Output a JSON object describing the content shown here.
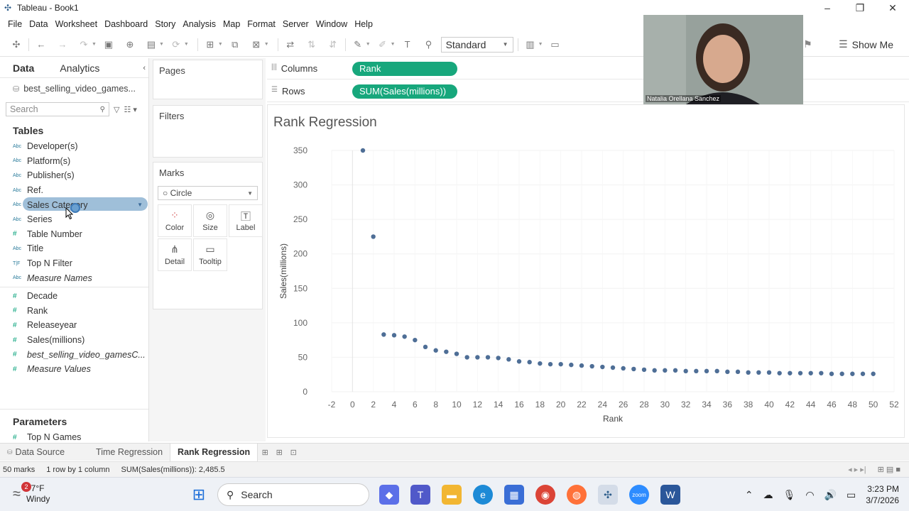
{
  "window": {
    "title": "Tableau - Book1"
  },
  "menu": [
    "File",
    "Data",
    "Worksheet",
    "Dashboard",
    "Story",
    "Analysis",
    "Map",
    "Format",
    "Server",
    "Window",
    "Help"
  ],
  "toolbar": {
    "fit": "Standard",
    "show_me": "Show Me"
  },
  "left_pane": {
    "tabs": [
      "Data",
      "Analytics"
    ],
    "datasource": "best_selling_video_games...",
    "search_placeholder": "Search",
    "tables_heading": "Tables",
    "dimensions": [
      {
        "name": "Developer(s)",
        "type": "Abc"
      },
      {
        "name": "Platform(s)",
        "type": "Abc"
      },
      {
        "name": "Publisher(s)",
        "type": "Abc"
      },
      {
        "name": "Ref.",
        "type": "Abc"
      },
      {
        "name": "Sales Category",
        "type": "Abc",
        "selected": true
      },
      {
        "name": "Series",
        "type": "Abc"
      },
      {
        "name": "Table Number",
        "type": "#"
      },
      {
        "name": "Title",
        "type": "Abc"
      },
      {
        "name": "Top N Filter",
        "type": "T|F"
      },
      {
        "name": "Measure Names",
        "type": "Abc",
        "italic": true
      }
    ],
    "measures": [
      {
        "name": "Decade",
        "type": "#"
      },
      {
        "name": "Rank",
        "type": "#"
      },
      {
        "name": "Releaseyear",
        "type": "#"
      },
      {
        "name": "Sales(millions)",
        "type": "#"
      },
      {
        "name": "best_selling_video_gamesC...",
        "type": "#",
        "italic": true
      },
      {
        "name": "Measure Values",
        "type": "#",
        "italic": true
      }
    ],
    "parameters_heading": "Parameters",
    "parameters": [
      {
        "name": "Top N Games",
        "type": "#"
      }
    ]
  },
  "cards": {
    "pages": "Pages",
    "filters": "Filters",
    "marks": "Marks",
    "mark_type": "Circle",
    "mark_buttons": [
      "Color",
      "Size",
      "Label",
      "Detail",
      "Tooltip"
    ]
  },
  "shelves": {
    "columns_label": "Columns",
    "columns_pill": "Rank",
    "rows_label": "Rows",
    "rows_pill": "SUM(Sales(millions))"
  },
  "webcam": {
    "name": "Natalia Orellana Sanchez"
  },
  "chart_data": {
    "type": "scatter",
    "title": "Rank Regression",
    "xlabel": "Rank",
    "ylabel": "Sales(millions)",
    "xlim": [
      -2,
      52
    ],
    "ylim": [
      0,
      350
    ],
    "x_ticks": [
      -2,
      0,
      2,
      4,
      6,
      8,
      10,
      12,
      14,
      16,
      18,
      20,
      22,
      24,
      26,
      28,
      30,
      32,
      34,
      36,
      38,
      40,
      42,
      44,
      46,
      48,
      50,
      52
    ],
    "y_ticks": [
      0,
      50,
      100,
      150,
      200,
      250,
      300,
      350
    ],
    "color": "#4e6e96",
    "points": [
      [
        1,
        350
      ],
      [
        2,
        225
      ],
      [
        3,
        83
      ],
      [
        4,
        82
      ],
      [
        5,
        80
      ],
      [
        6,
        75
      ],
      [
        7,
        65
      ],
      [
        8,
        60
      ],
      [
        9,
        58
      ],
      [
        10,
        55
      ],
      [
        11,
        50
      ],
      [
        12,
        50
      ],
      [
        13,
        50
      ],
      [
        14,
        49
      ],
      [
        15,
        47
      ],
      [
        16,
        44
      ],
      [
        17,
        43
      ],
      [
        18,
        41
      ],
      [
        19,
        40
      ],
      [
        20,
        40
      ],
      [
        21,
        39
      ],
      [
        22,
        38
      ],
      [
        23,
        37
      ],
      [
        24,
        36
      ],
      [
        25,
        35
      ],
      [
        26,
        34
      ],
      [
        27,
        33
      ],
      [
        28,
        32
      ],
      [
        29,
        31
      ],
      [
        30,
        31
      ],
      [
        31,
        31
      ],
      [
        32,
        30
      ],
      [
        33,
        30
      ],
      [
        34,
        30
      ],
      [
        35,
        30
      ],
      [
        36,
        29
      ],
      [
        37,
        29
      ],
      [
        38,
        28
      ],
      [
        39,
        28
      ],
      [
        40,
        28
      ],
      [
        41,
        27
      ],
      [
        42,
        27
      ],
      [
        43,
        27
      ],
      [
        44,
        27
      ],
      [
        45,
        27
      ],
      [
        46,
        26
      ],
      [
        47,
        26
      ],
      [
        48,
        26
      ],
      [
        49,
        26
      ],
      [
        50,
        26
      ]
    ]
  },
  "sheet_tabs": [
    "Data Source",
    "Time Regression",
    "Rank Regression"
  ],
  "status": {
    "marks": "50 marks",
    "dims": "1 row by 1 column",
    "sum": "SUM(Sales(millions)): 2,485.5"
  },
  "taskbar": {
    "weather_badge": "2",
    "temp": "77°F",
    "condition": "Windy",
    "search": "Search",
    "time": "3:23 PM",
    "date": "3/7/2026"
  }
}
